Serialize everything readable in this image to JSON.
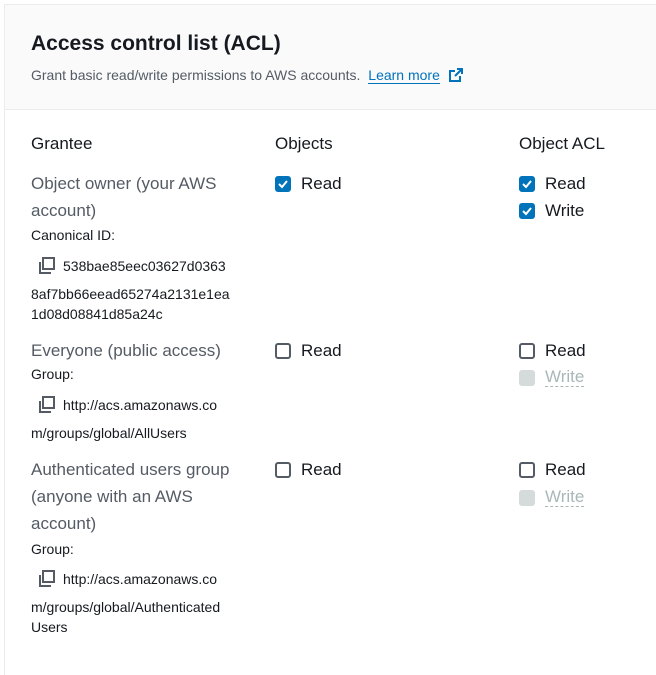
{
  "header": {
    "title": "Access control list (ACL)",
    "description": "Grant basic read/write permissions to AWS accounts.",
    "learn_more": "Learn more"
  },
  "columns": {
    "grantee": "Grantee",
    "objects": "Objects",
    "object_acl": "Object ACL"
  },
  "rows": [
    {
      "grantee": "Object owner (your AWS account)",
      "id_label": "Canonical ID:",
      "id_lines": [
        "538bae85eec03627d0363",
        "8af7bb66eead65274a2131e1ea",
        "1d08d08841d85a24c"
      ],
      "objects_read": {
        "label": "Read",
        "checked": true
      },
      "acl_read": {
        "label": "Read",
        "checked": true
      },
      "acl_write": {
        "label": "Write",
        "checked": true,
        "disabled": false
      }
    },
    {
      "grantee": "Everyone (public access)",
      "id_label": "Group:",
      "id_lines": [
        "http://acs.amazonaws.co",
        "m/groups/global/AllUsers"
      ],
      "objects_read": {
        "label": "Read",
        "checked": false
      },
      "acl_read": {
        "label": "Read",
        "checked": false
      },
      "acl_write": {
        "label": "Write",
        "checked": false,
        "disabled": true
      }
    },
    {
      "grantee": "Authenticated users group (anyone with an AWS account)",
      "id_label": "Group:",
      "id_lines": [
        "http://acs.amazonaws.co",
        "m/groups/global/Authenticated",
        "Users"
      ],
      "objects_read": {
        "label": "Read",
        "checked": false
      },
      "acl_read": {
        "label": "Read",
        "checked": false
      },
      "acl_write": {
        "label": "Write",
        "checked": false,
        "disabled": true
      }
    }
  ],
  "colors": {
    "accent": "#0073bb",
    "disabled": "#aab7b8"
  },
  "icons": {
    "external": "external-link-icon",
    "copy": "copy-icon",
    "check": "check-icon"
  }
}
